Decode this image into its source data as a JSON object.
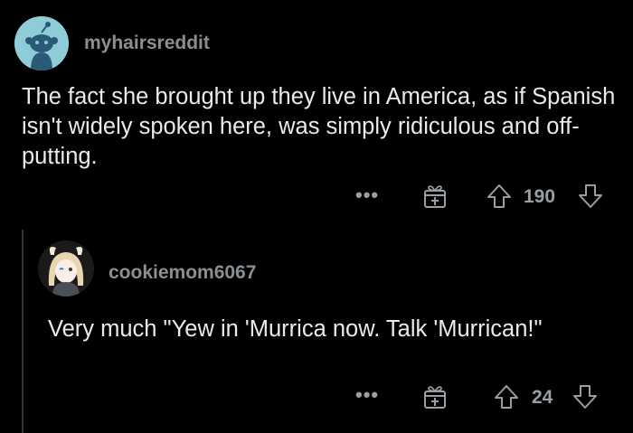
{
  "comment": {
    "username": "myhairsreddit",
    "text": "The fact she brought up they live in America, as if Spanish isn't widely spoken here, was simply ridiculous and off-putting.",
    "votes": "190",
    "avatar_icon": "reddit-snoo-avatar-icon"
  },
  "reply": {
    "username": "cookiemom6067",
    "text": "Very much \"Yew in 'Murrica now. Talk 'Murrican!\"",
    "votes": "24",
    "avatar_icon": "anime-character-avatar-icon"
  },
  "icons": {
    "more": "more-options-icon",
    "award": "award-gift-icon",
    "upvote": "upvote-arrow-icon",
    "downvote": "downvote-arrow-icon"
  },
  "colors": {
    "background": "#000000",
    "text": "#e8eaec",
    "meta": "#9a9fa4",
    "avatar_bg": "#8ecdd8"
  },
  "more_label": "•••"
}
